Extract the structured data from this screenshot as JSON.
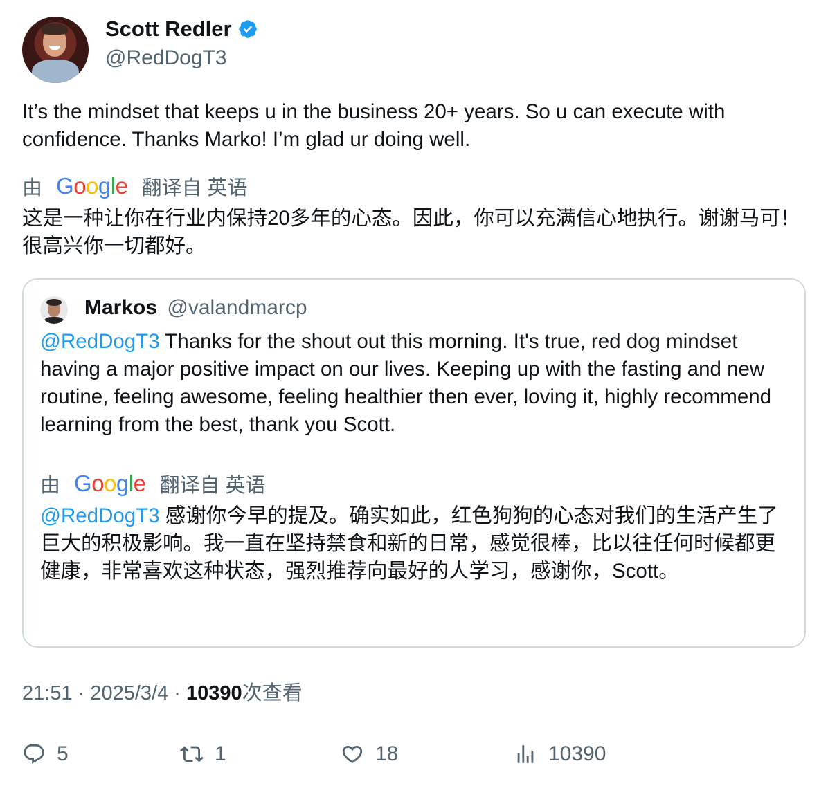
{
  "author": {
    "display_name": "Scott Redler",
    "handle": "@RedDogT3",
    "verified": true
  },
  "tweet": {
    "text": "It’s the mindset that keeps u in the business 20+ years.  So u can execute with confidence.  Thanks Marko! I’m glad ur doing well.",
    "translation_by_prefix": "由",
    "translation_by_brand": "Google",
    "translation_by_suffix": "翻译自 英语",
    "translated_text": "这是一种让你在行业内保持20多年的心态。因此，你可以充满信心地执行。谢谢马可！很高兴你一切都好。"
  },
  "quoted_tweet": {
    "display_name": "Markos",
    "handle": "@valandmarcp",
    "mention": "@RedDogT3",
    "text": " Thanks for the shout out this morning. It's true, red dog mindset having a major positive impact on our lives. Keeping up with the fasting and new routine, feeling awesome, feeling healthier then ever, loving it, highly recommend learning from the best, thank you Scott.",
    "translation_by_prefix": "由",
    "translation_by_brand": "Google",
    "translation_by_suffix": "翻译自 英语",
    "translated_mention": "@RedDogT3",
    "translated_text": " 感谢你今早的提及。确实如此，红色狗狗的心态对我们的生活产生了巨大的积极影响。我一直在坚持禁食和新的日常，感觉很棒，比以往任何时候都更健康，非常喜欢这种状态，强烈推荐向最好的人学习，感谢你，Scott。"
  },
  "meta": {
    "time": "21:51",
    "separator": " · ",
    "date": "2025/3/4",
    "views_count": "10390",
    "views_label": "次查看"
  },
  "actions": {
    "replies": "5",
    "retweets": "1",
    "likes": "18",
    "views": "10390"
  },
  "colors": {
    "accent": "#1d9bf0",
    "secondary_text": "#536471",
    "border": "#cfd9de"
  }
}
